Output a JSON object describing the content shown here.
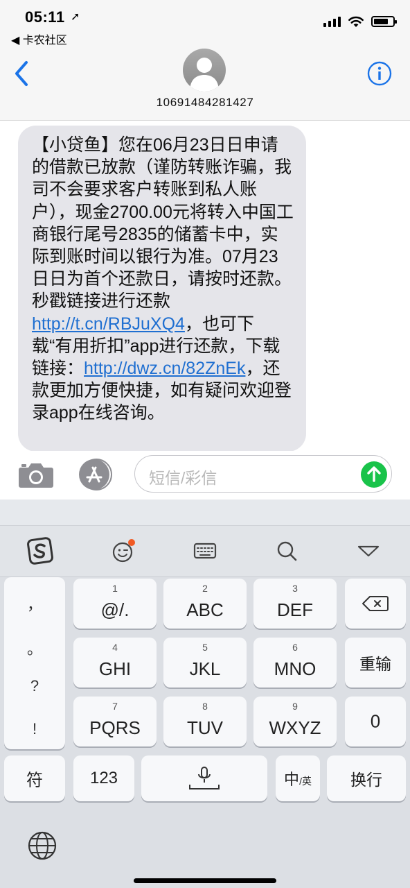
{
  "status": {
    "time": "05:11",
    "location_arrow": "➚",
    "back_app": "◀ 卡农社区",
    "battery_level": 0.78
  },
  "header": {
    "contact_number": "10691484281427"
  },
  "message": {
    "text_before_link1": "【小贷鱼】您在06月23日日申请的借款已放款（谨防转账诈骗，我司不会要求客户转账到私人账户），现金2700.00元将转入中国工商银行尾号2835的储蓄卡中，实际到账时间以银行为准。07月23日日为首个还款日，请按时还款。秒戳链接进行还款",
    "link1": "http://t.cn/RBJuXQ4",
    "text_between_links": "，也可下载“有用折扣”app进行还款，下载链接：",
    "link2": "http://dwz.cn/82ZnEk",
    "text_after_link2": "，还款更加方便快捷，如有疑问欢迎登录app在线咨询。"
  },
  "compose": {
    "placeholder": "短信/彩信"
  },
  "keyboard": {
    "punctuation": [
      "，",
      "。",
      "?",
      "!"
    ],
    "rows": [
      [
        {
          "num": "1",
          "label": "@/."
        },
        {
          "num": "2",
          "label": "ABC"
        },
        {
          "num": "3",
          "label": "DEF"
        }
      ],
      [
        {
          "num": "4",
          "label": "GHI"
        },
        {
          "num": "5",
          "label": "JKL"
        },
        {
          "num": "6",
          "label": "MNO"
        }
      ],
      [
        {
          "num": "7",
          "label": "PQRS"
        },
        {
          "num": "8",
          "label": "TUV"
        },
        {
          "num": "9",
          "label": "WXYZ"
        }
      ]
    ],
    "reenter_label": "重输",
    "zero_label": "0",
    "symbol_label": "符",
    "numeric_label": "123",
    "lang_main": "中",
    "lang_sub": "/英",
    "return_label": "换行"
  },
  "icons": {
    "toolbar": [
      "sogou-logo-icon",
      "emoji-icon",
      "keyboard-icon",
      "search-icon",
      "collapse-icon"
    ],
    "compose": [
      "camera-icon",
      "app-store-icon",
      "send-arrow-icon"
    ],
    "accent_blue": "#1f6fd1",
    "send_green": "#19c34a"
  }
}
